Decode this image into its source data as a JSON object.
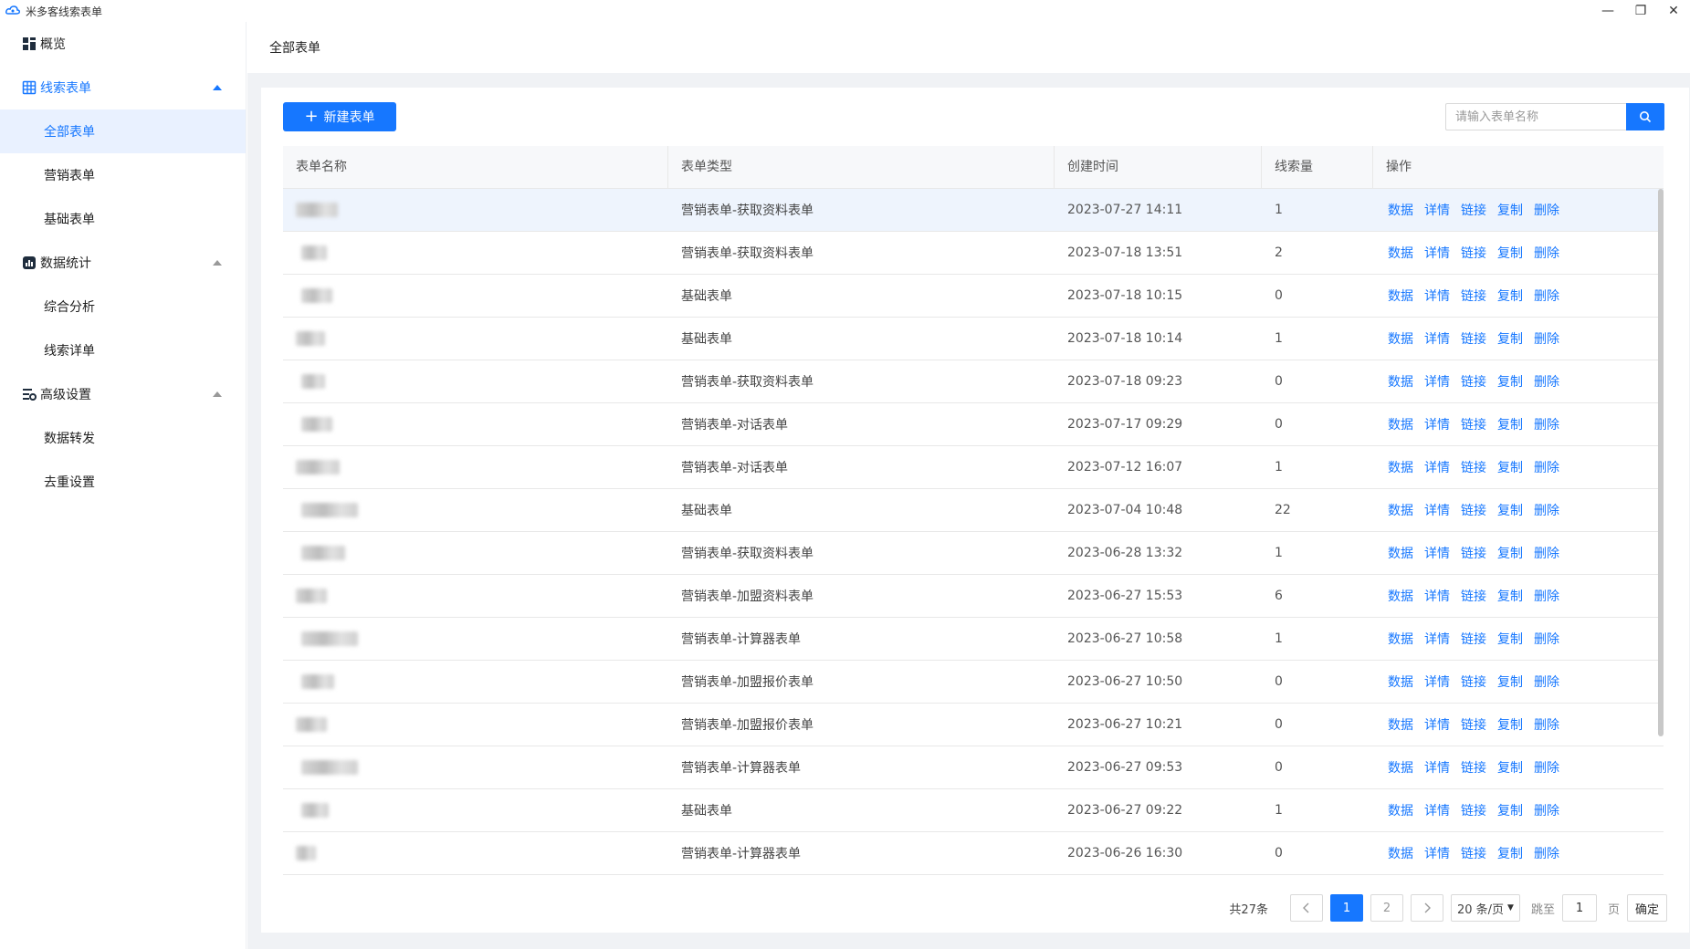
{
  "window": {
    "title": "米多客线索表单"
  },
  "sidebar": {
    "overview": "概览",
    "groups": [
      {
        "label": "线索表单",
        "icon": "table-icon",
        "items": [
          "全部表单",
          "营销表单",
          "基础表单"
        ]
      },
      {
        "label": "数据统计",
        "icon": "chart-icon",
        "items": [
          "综合分析",
          "线索详单"
        ]
      },
      {
        "label": "高级设置",
        "icon": "settings-icon",
        "items": [
          "数据转发",
          "去重设置"
        ]
      }
    ]
  },
  "header": {
    "title": "全部表单"
  },
  "toolbar": {
    "new_button": "新建表单",
    "search_placeholder": "请输入表单名称"
  },
  "table": {
    "columns": [
      "表单名称",
      "表单类型",
      "创建时间",
      "线索量",
      "操作"
    ],
    "actions": [
      "数据",
      "详情",
      "链接",
      "复制",
      "删除"
    ],
    "rows": [
      {
        "type": "营销表单-获取资料表单",
        "time": "2023-07-27 14:11",
        "count": "1"
      },
      {
        "type": "营销表单-获取资料表单",
        "time": "2023-07-18 13:51",
        "count": "2"
      },
      {
        "type": "基础表单",
        "time": "2023-07-18 10:15",
        "count": "0"
      },
      {
        "type": "基础表单",
        "time": "2023-07-18 10:14",
        "count": "1"
      },
      {
        "type": "营销表单-获取资料表单",
        "time": "2023-07-18 09:23",
        "count": "0"
      },
      {
        "type": "营销表单-对话表单",
        "time": "2023-07-17 09:29",
        "count": "0"
      },
      {
        "type": "营销表单-对话表单",
        "time": "2023-07-12 16:07",
        "count": "1"
      },
      {
        "type": "基础表单",
        "time": "2023-07-04 10:48",
        "count": "22"
      },
      {
        "type": "营销表单-获取资料表单",
        "time": "2023-06-28 13:32",
        "count": "1"
      },
      {
        "type": "营销表单-加盟资料表单",
        "time": "2023-06-27 15:53",
        "count": "6"
      },
      {
        "type": "营销表单-计算器表单",
        "time": "2023-06-27 10:58",
        "count": "1"
      },
      {
        "type": "营销表单-加盟报价表单",
        "time": "2023-06-27 10:50",
        "count": "0"
      },
      {
        "type": "营销表单-加盟报价表单",
        "time": "2023-06-27 10:21",
        "count": "0"
      },
      {
        "type": "营销表单-计算器表单",
        "time": "2023-06-27 09:53",
        "count": "0"
      },
      {
        "type": "基础表单",
        "time": "2023-06-27 09:22",
        "count": "1"
      },
      {
        "type": "营销表单-计算器表单",
        "time": "2023-06-26 16:30",
        "count": "0"
      }
    ]
  },
  "pagination": {
    "total": "共27条",
    "pages": [
      "1",
      "2"
    ],
    "current": "1",
    "page_size": "20 条/页",
    "jump_label": "跳至",
    "jump_value": "1",
    "page_unit": "页",
    "confirm": "确定"
  },
  "colors": {
    "accent": "#1677ff",
    "highlight_row": "#eef4fd",
    "background": "#f0f2f5"
  }
}
